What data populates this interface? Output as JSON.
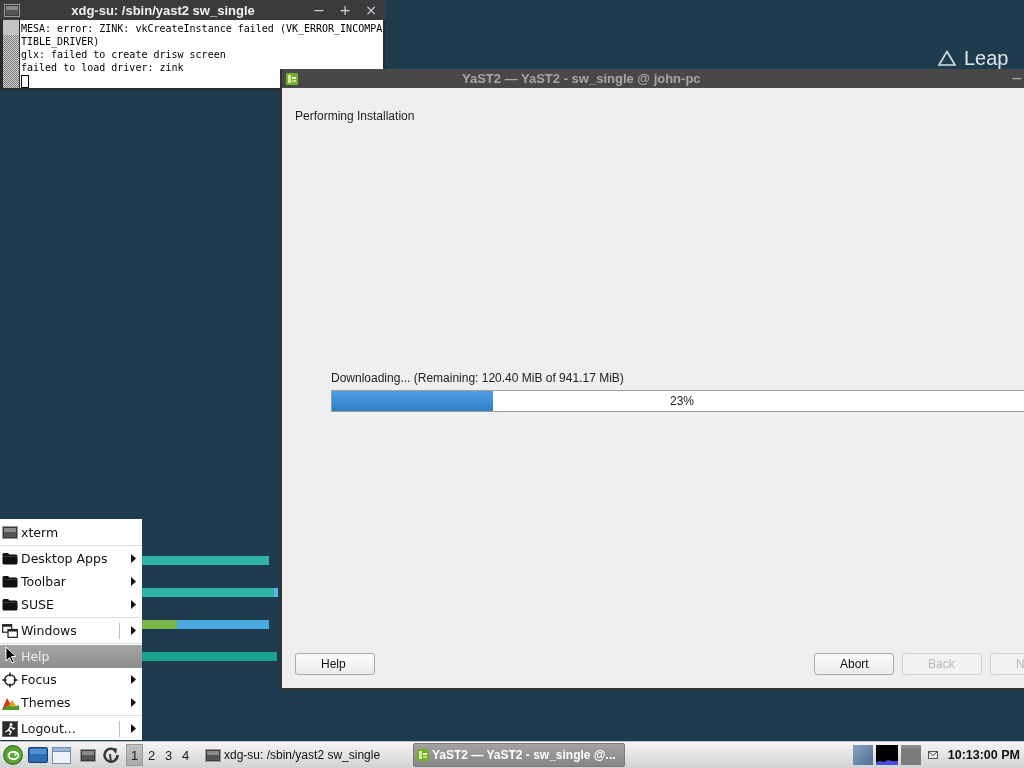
{
  "desktop": {
    "logo_text": "Leap"
  },
  "terminal_window": {
    "title": "xdg-su: /sbin/yast2 sw_single",
    "controls": [
      "−",
      "+",
      "×"
    ],
    "lines": [
      "MESA: error: ZINK: vkCreateInstance failed (VK_ERROR_INCOMPATIBLE_DRIVER)",
      "glx: failed to create drisw screen",
      "failed to load driver: zink"
    ]
  },
  "yast_window": {
    "title": "YaST2 — YaST2 - sw_single @ john-pc",
    "controls": [
      "−"
    ],
    "heading": "Performing Installation",
    "progress": {
      "label": "Downloading... (Remaining: 120.40 MiB of 941.17 MiB)",
      "level": 0.23,
      "reading": "23%"
    },
    "left_buttons": [
      {
        "label": "Help",
        "disabled": false
      }
    ],
    "right_buttons": [
      {
        "label": "Abort",
        "disabled": false
      },
      {
        "label": "Back",
        "disabled": true
      },
      {
        "label": "N",
        "disabled": true
      }
    ]
  },
  "menu": {
    "sections": [
      {
        "items": [
          {
            "label": "xterm",
            "kind": "launcher",
            "selected": false
          }
        ]
      },
      {
        "items": [
          {
            "label": "Desktop Apps",
            "kind": "submenu",
            "selected": false
          },
          {
            "label": "Toolbar",
            "kind": "submenu",
            "selected": false
          },
          {
            "label": "SUSE",
            "kind": "submenu",
            "selected": false
          }
        ]
      },
      {
        "items": [
          {
            "label": "Windows",
            "kind": "split",
            "selected": false
          }
        ]
      },
      {
        "items": [
          {
            "label": "Help",
            "kind": "launcher",
            "selected": true
          },
          {
            "label": "Focus",
            "kind": "submenu",
            "selected": false
          },
          {
            "label": "Themes",
            "kind": "submenu",
            "selected": false
          }
        ]
      },
      {
        "items": [
          {
            "label": "Logout...",
            "kind": "split",
            "selected": false
          }
        ]
      }
    ]
  },
  "taskbar": {
    "pager": [
      {
        "label": "1",
        "selected": true
      },
      {
        "label": "2",
        "selected": false
      },
      {
        "label": "3",
        "selected": false
      },
      {
        "label": "4",
        "selected": false
      }
    ],
    "tasks": [
      {
        "title": "xdg-su: /sbin/yast2 sw_single",
        "selected": false
      },
      {
        "title": "YaST2 — YaST2 - sw_single @...",
        "selected": true
      }
    ],
    "clock": "10:13:00 PM"
  }
}
